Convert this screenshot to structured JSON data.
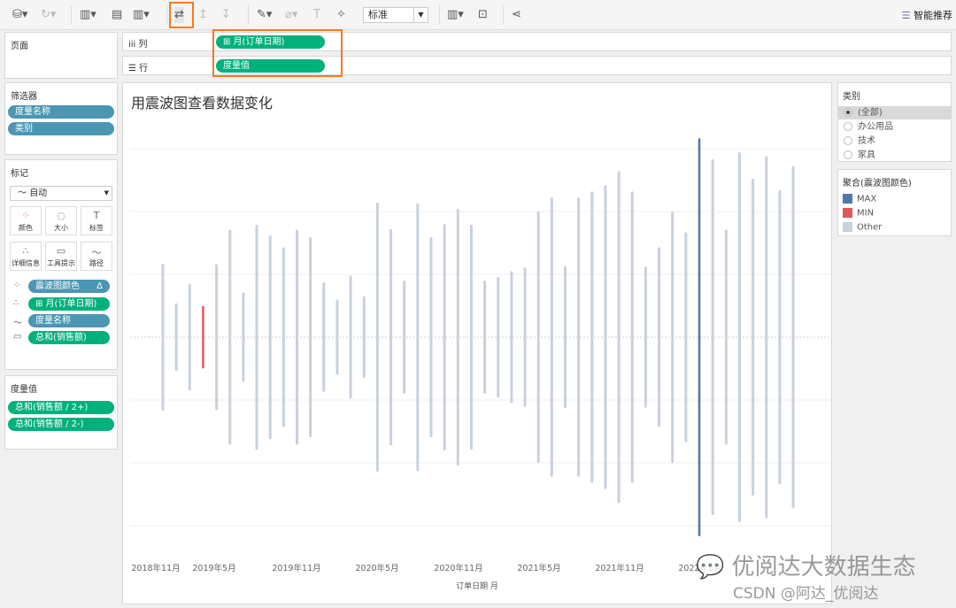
{
  "toolbar": {
    "mark_size_select": "标准",
    "smart_recommend": "智能推荐"
  },
  "shelves": {
    "pages_label": "页面",
    "columns_label": "列",
    "rows_label": "行",
    "columns_pill": "⊞ 月(订单日期)",
    "rows_pill": "度量值"
  },
  "filters": {
    "title": "筛选器",
    "items": [
      "度量名称",
      "类别"
    ]
  },
  "marks": {
    "title": "标记",
    "type": "自动",
    "buttons": [
      "颜色",
      "大小",
      "标签",
      "详细信息",
      "工具提示",
      "路径"
    ],
    "fields": [
      {
        "icon": "color-icon",
        "label": "震波图颜色",
        "suffix": "Δ",
        "color": "blue"
      },
      {
        "icon": "detail-icon",
        "label": "⊞ 月(订单日期)",
        "color": "green"
      },
      {
        "icon": "path-icon",
        "label": "度量名称",
        "color": "blue"
      },
      {
        "icon": "tooltip-icon",
        "label": "总和(销售额)",
        "color": "green"
      }
    ]
  },
  "measure_values": {
    "title": "度量值",
    "items": [
      "总和(销售额 / 2+)",
      "总和(销售额 / 2-)"
    ]
  },
  "category_filter": {
    "title": "类别",
    "options": [
      {
        "label": "(全部)",
        "selected": true
      },
      {
        "label": "办公用品",
        "selected": false
      },
      {
        "label": "技术",
        "selected": false
      },
      {
        "label": "家具",
        "selected": false
      }
    ]
  },
  "color_legend": {
    "title": "聚合(震波图颜色)",
    "items": [
      {
        "label": "MAX",
        "color": "#4e79a7"
      },
      {
        "label": "MIN",
        "color": "#e15759"
      },
      {
        "label": "Other",
        "color": "#c8d1dc"
      }
    ]
  },
  "watermark": {
    "line1": "优阅达大数据生态",
    "line2": "CSDN @阿达_优阅达"
  },
  "chart_data": {
    "type": "bar",
    "title": "用震波图查看数据变化",
    "xlabel": "订单日期 月",
    "ylabel": "",
    "x_tick_labels": [
      "2018年11月",
      "2019年5月",
      "2019年11月",
      "2020年5月",
      "2020年11月",
      "2021年5月",
      "2021年11月",
      "2022年5月"
    ],
    "note_values": "symmetric bars: half-amplitude above and below zero line, no y-axis labels printed (relative units)",
    "grid": true,
    "categories": [
      "2019-01",
      "2019-02",
      "2019-03",
      "2019-04",
      "2019-05",
      "2019-06",
      "2019-07",
      "2019-08",
      "2019-09",
      "2019-10",
      "2019-11",
      "2019-12",
      "2020-01",
      "2020-02",
      "2020-03",
      "2020-04",
      "2020-05",
      "2020-06",
      "2020-07",
      "2020-08",
      "2020-09",
      "2020-10",
      "2020-11",
      "2020-12",
      "2021-01",
      "2021-02",
      "2021-03",
      "2021-04",
      "2021-05",
      "2021-06",
      "2021-07",
      "2021-08",
      "2021-09",
      "2021-10",
      "2021-11",
      "2021-12",
      "2022-01",
      "2022-02",
      "2022-03",
      "2022-04",
      "2022-05",
      "2022-06",
      "2022-07",
      "2022-08",
      "2022-09",
      "2022-10",
      "2022-11",
      "2022-12"
    ],
    "values": [
      1.15,
      0.52,
      0.83,
      0.48,
      1.14,
      1.69,
      0.69,
      1.77,
      1.6,
      1.41,
      1.69,
      1.57,
      0.85,
      0.58,
      0.96,
      0.63,
      2.12,
      1.7,
      0.88,
      2.11,
      1.57,
      1.78,
      2.02,
      1.77,
      0.88,
      0.94,
      1.03,
      1.09,
      1.98,
      2.2,
      1.11,
      2.2,
      2.3,
      2.4,
      2.62,
      2.3,
      1.1,
      1.41,
      1.98,
      1.65,
      3.15,
      2.81,
      1.69,
      2.92,
      2.5,
      2.86,
      2.32,
      2.7
    ],
    "colors": [
      "Other",
      "Other",
      "Other",
      "MIN",
      "Other",
      "Other",
      "Other",
      "Other",
      "Other",
      "Other",
      "Other",
      "Other",
      "Other",
      "Other",
      "Other",
      "Other",
      "Other",
      "Other",
      "Other",
      "Other",
      "Other",
      "Other",
      "Other",
      "Other",
      "Other",
      "Other",
      "Other",
      "Other",
      "Other",
      "Other",
      "Other",
      "Other",
      "Other",
      "Other",
      "Other",
      "Other",
      "Other",
      "Other",
      "Other",
      "Other",
      "MAX",
      "Other",
      "Other",
      "Other",
      "Other",
      "Other",
      "Other",
      "Other"
    ]
  }
}
